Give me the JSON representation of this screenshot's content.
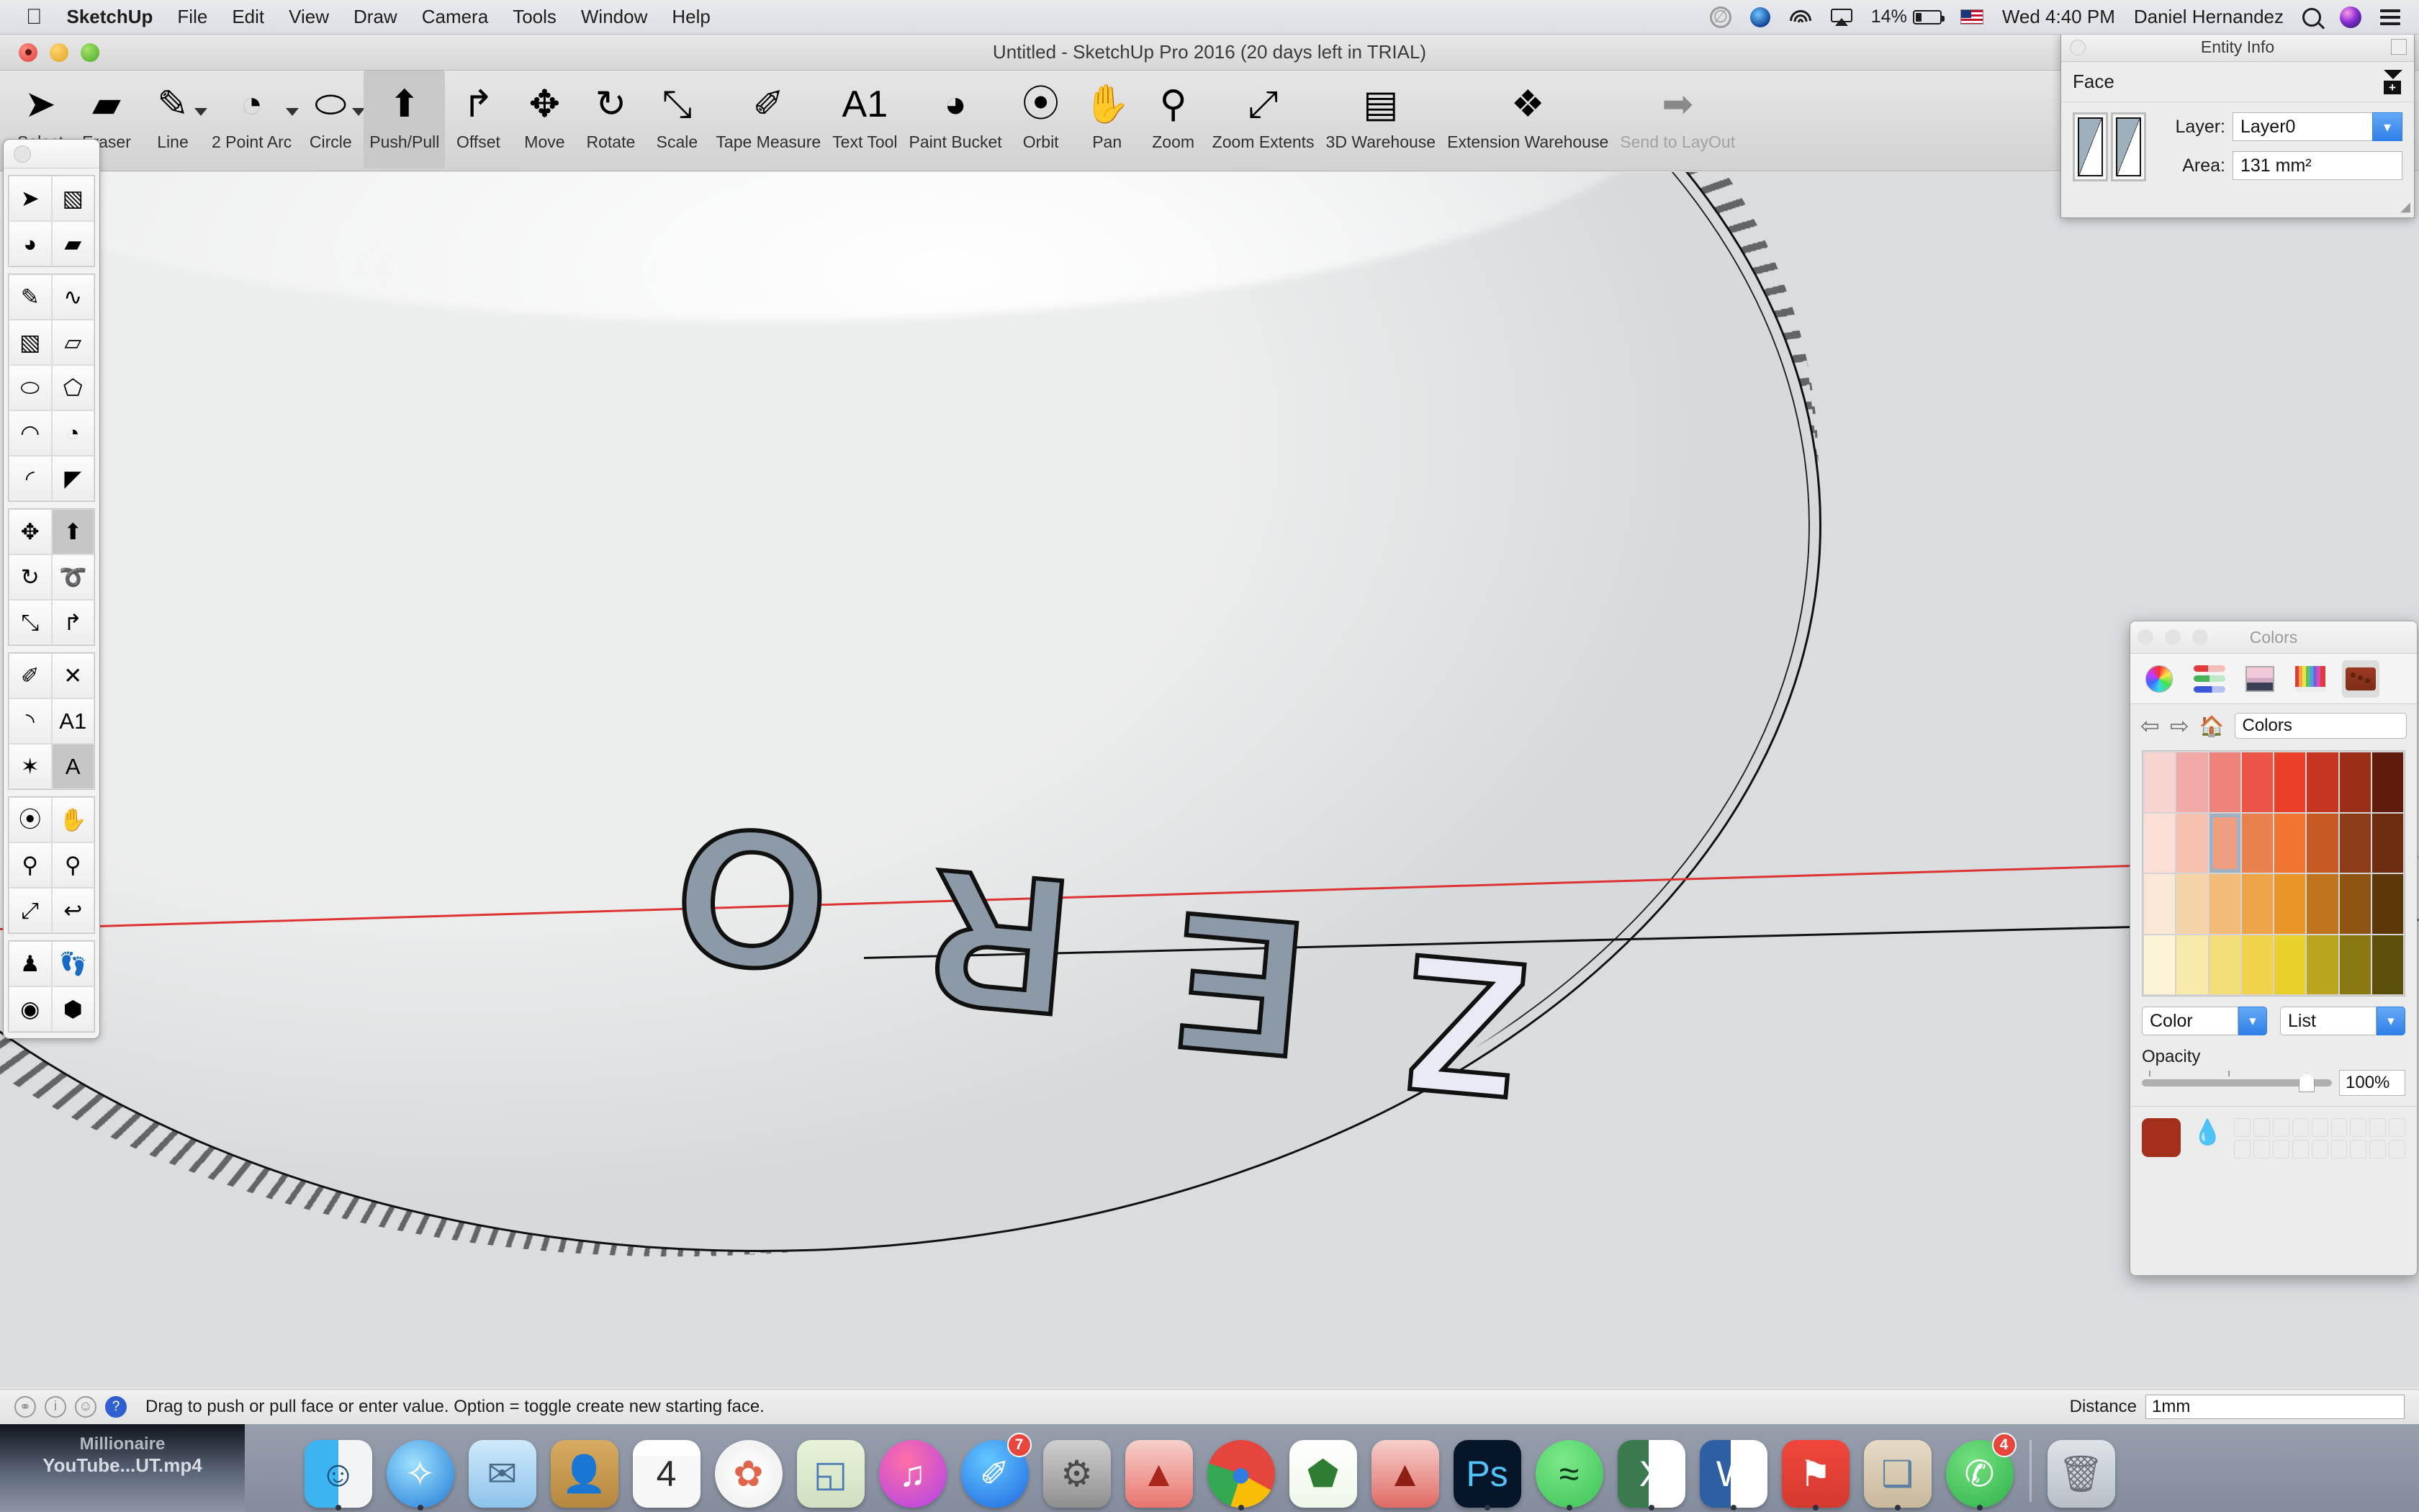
{
  "menubar": {
    "apple_icon": "apple-icon",
    "items": [
      "SketchUp",
      "File",
      "Edit",
      "View",
      "Draw",
      "Camera",
      "Tools",
      "Window",
      "Help"
    ],
    "status": {
      "creative_cloud_icon": "creative-cloud-icon",
      "dropbox_icon": "dropbox-icon",
      "wifi_icon": "wifi-icon",
      "airplay_icon": "airplay-icon",
      "battery_percent": "14%",
      "flag_icon": "us-flag-icon",
      "clock": "Wed 4:40 PM",
      "user": "Daniel Hernandez",
      "search_icon": "spotlight-search-icon",
      "siri_icon": "siri-icon",
      "notification_icon": "notification-center-icon"
    }
  },
  "window": {
    "title": "Untitled - SketchUp Pro 2016 (20 days left in TRIAL)"
  },
  "toolbar": {
    "items": [
      {
        "label": "Select",
        "icon": "arrow-cursor-icon",
        "glyph": "➤",
        "caret": false,
        "active": false,
        "disabled": false
      },
      {
        "label": "Eraser",
        "icon": "eraser-icon",
        "glyph": "▰",
        "caret": false,
        "active": false,
        "disabled": false
      },
      {
        "label": "Line",
        "icon": "pencil-line-icon",
        "glyph": "✎",
        "caret": true,
        "active": false,
        "disabled": false
      },
      {
        "label": "2 Point Arc",
        "icon": "two-point-arc-icon",
        "glyph": "◔",
        "caret": true,
        "active": false,
        "disabled": false
      },
      {
        "label": "Circle",
        "icon": "circle-icon",
        "glyph": "⬭",
        "caret": true,
        "active": false,
        "disabled": false
      },
      {
        "label": "Push/Pull",
        "icon": "push-pull-icon",
        "glyph": "⬆",
        "caret": false,
        "active": true,
        "disabled": false
      },
      {
        "label": "Offset",
        "icon": "offset-icon",
        "glyph": "↱",
        "caret": false,
        "active": false,
        "disabled": false
      },
      {
        "label": "Move",
        "icon": "move-icon",
        "glyph": "✥",
        "caret": false,
        "active": false,
        "disabled": false
      },
      {
        "label": "Rotate",
        "icon": "rotate-icon",
        "glyph": "↻",
        "caret": false,
        "active": false,
        "disabled": false
      },
      {
        "label": "Scale",
        "icon": "scale-icon",
        "glyph": "⤡",
        "caret": false,
        "active": false,
        "disabled": false
      },
      {
        "label": "Tape Measure",
        "icon": "tape-measure-icon",
        "glyph": "✐",
        "caret": false,
        "active": false,
        "disabled": false
      },
      {
        "label": "Text Tool",
        "icon": "text-tool-icon",
        "glyph": "A1",
        "caret": false,
        "active": false,
        "disabled": false
      },
      {
        "label": "Paint Bucket",
        "icon": "paint-bucket-icon",
        "glyph": "◕",
        "caret": false,
        "active": false,
        "disabled": false
      },
      {
        "label": "Orbit",
        "icon": "orbit-icon",
        "glyph": "⦿",
        "caret": false,
        "active": false,
        "disabled": false
      },
      {
        "label": "Pan",
        "icon": "pan-hand-icon",
        "glyph": "✋",
        "caret": false,
        "active": false,
        "disabled": false
      },
      {
        "label": "Zoom",
        "icon": "zoom-icon",
        "glyph": "⚲",
        "caret": false,
        "active": false,
        "disabled": false
      },
      {
        "label": "Zoom Extents",
        "icon": "zoom-extents-icon",
        "glyph": "⤢",
        "caret": false,
        "active": false,
        "disabled": false
      },
      {
        "label": "3D Warehouse",
        "icon": "3d-warehouse-icon",
        "glyph": "▤",
        "caret": false,
        "active": false,
        "disabled": false
      },
      {
        "label": "Extension Warehouse",
        "icon": "extension-warehouse-icon",
        "glyph": "❖",
        "caret": false,
        "active": false,
        "disabled": false
      },
      {
        "label": "Send to LayOut",
        "icon": "send-to-layout-icon",
        "glyph": "➡",
        "caret": false,
        "active": false,
        "disabled": true
      }
    ]
  },
  "palette": {
    "groups": [
      {
        "cells": [
          {
            "icon": "select-arrow-icon",
            "glyph": "➤",
            "selected": false
          },
          {
            "icon": "make-component-icon",
            "glyph": "▧",
            "selected": false
          },
          {
            "icon": "paint-bucket-icon",
            "glyph": "◕",
            "selected": false
          },
          {
            "icon": "eraser-icon",
            "glyph": "▰",
            "selected": false
          }
        ]
      },
      {
        "cells": [
          {
            "icon": "pencil-line-icon",
            "glyph": "✎",
            "selected": false
          },
          {
            "icon": "freehand-icon",
            "glyph": "∿",
            "selected": false
          },
          {
            "icon": "rectangle-icon",
            "glyph": "▧",
            "selected": false
          },
          {
            "icon": "rotated-rectangle-icon",
            "glyph": "▱",
            "selected": false
          },
          {
            "icon": "circle-icon",
            "glyph": "⬭",
            "selected": false
          },
          {
            "icon": "polygon-icon",
            "glyph": "⬠",
            "selected": false
          },
          {
            "icon": "arc-icon",
            "glyph": "◠",
            "selected": false
          },
          {
            "icon": "two-point-arc-icon",
            "glyph": "◔",
            "selected": false
          },
          {
            "icon": "three-point-arc-icon",
            "glyph": "◜",
            "selected": false
          },
          {
            "icon": "pie-icon",
            "glyph": "◤",
            "selected": false
          }
        ]
      },
      {
        "cells": [
          {
            "icon": "move-icon",
            "glyph": "✥",
            "selected": false
          },
          {
            "icon": "push-pull-icon",
            "glyph": "⬆",
            "selected": true
          },
          {
            "icon": "rotate-icon",
            "glyph": "↻",
            "selected": false
          },
          {
            "icon": "follow-me-icon",
            "glyph": "➰",
            "selected": false
          },
          {
            "icon": "scale-icon",
            "glyph": "⤡",
            "selected": false
          },
          {
            "icon": "offset-icon",
            "glyph": "↱",
            "selected": false
          }
        ]
      },
      {
        "cells": [
          {
            "icon": "tape-measure-icon",
            "glyph": "✐",
            "selected": false
          },
          {
            "icon": "dimension-icon",
            "glyph": "✕",
            "selected": false
          },
          {
            "icon": "protractor-icon",
            "glyph": "◝",
            "selected": false
          },
          {
            "icon": "text-tool-icon",
            "glyph": "A1",
            "selected": false
          },
          {
            "icon": "axes-icon",
            "glyph": "✶",
            "selected": false
          },
          {
            "icon": "3d-text-icon",
            "glyph": "A",
            "selected": true
          }
        ]
      },
      {
        "cells": [
          {
            "icon": "orbit-icon",
            "glyph": "⦿",
            "selected": false
          },
          {
            "icon": "pan-hand-icon",
            "glyph": "✋",
            "selected": false
          },
          {
            "icon": "zoom-icon",
            "glyph": "⚲",
            "selected": false
          },
          {
            "icon": "zoom-window-icon",
            "glyph": "⚲",
            "selected": false
          },
          {
            "icon": "zoom-extents-icon",
            "glyph": "⤢",
            "selected": false
          },
          {
            "icon": "previous-view-icon",
            "glyph": "↩",
            "selected": false
          }
        ]
      },
      {
        "cells": [
          {
            "icon": "position-camera-icon",
            "glyph": "♟",
            "selected": false
          },
          {
            "icon": "walk-icon",
            "glyph": "👣",
            "selected": false
          },
          {
            "icon": "look-around-icon",
            "glyph": "◉",
            "selected": false
          },
          {
            "icon": "section-plane-icon",
            "glyph": "⬢",
            "selected": false
          }
        ]
      }
    ]
  },
  "entity_info": {
    "panel_title": "Entity Info",
    "entity_type": "Face",
    "layer_label": "Layer:",
    "layer_value": "Layer0",
    "area_label": "Area:",
    "area_value": "131 mm²",
    "expand_icon": "expand-collapse-icon",
    "front_face_icon": "front-face-swatch-icon",
    "back_face_icon": "back-face-swatch-icon"
  },
  "colors_panel": {
    "panel_title": "Colors",
    "tabs": [
      {
        "name": "color-wheel-tab",
        "selected": false
      },
      {
        "name": "color-sliders-tab",
        "selected": false
      },
      {
        "name": "color-palettes-tab",
        "selected": false
      },
      {
        "name": "image-palettes-tab",
        "selected": false
      },
      {
        "name": "crayons-tab",
        "selected": false
      },
      {
        "name": "sketchup-materials-tab",
        "selected": true
      }
    ],
    "nav": {
      "back_icon": "back-arrow-icon",
      "forward_icon": "forward-arrow-icon",
      "home_icon": "home-icon",
      "field_value": "Colors"
    },
    "swatches": [
      "#f7d4d0",
      "#f2aaa6",
      "#ef8279",
      "#ea5548",
      "#ea4028",
      "#c63520",
      "#9c2d17",
      "#5f1a0c",
      "#fbdfd6",
      "#f4c2ae",
      "#ef9e81",
      "#ea7f50",
      "#ef7530",
      "#c75a22",
      "#8c3c17",
      "#6e2d11",
      "#fbe8d4",
      "#f6d3a7",
      "#f2bb78",
      "#eda447",
      "#e99528",
      "#c0741c",
      "#8d5414",
      "#5e3709",
      "#fdf4d6",
      "#f9e9a8",
      "#f4de79",
      "#f0d34b",
      "#ead02a",
      "#bba51c",
      "#8a7812",
      "#5c4f0a"
    ],
    "selected_swatch_index": 10,
    "selected_swatch_color": "#9c2d17",
    "left_popup": "Color",
    "right_popup": "List",
    "opacity_label": "Opacity",
    "opacity_value": "100%",
    "current_color": "#a4301b",
    "eyedropper_icon": "eyedropper-icon"
  },
  "model": {
    "text_on_cylinder": "ZERO",
    "face_fill_color": "#8c9aa8",
    "selected_letter": "Z",
    "selected_letter_fill": "#e8eaf6"
  },
  "status_bar": {
    "icons": [
      "privacy-icon",
      "info-icon",
      "person-icon",
      "help-icon"
    ],
    "message": "Drag to push or pull face or enter value.  Option = toggle create new starting face.",
    "distance_label": "Distance",
    "distance_value": "1mm"
  },
  "dock": {
    "items": [
      {
        "name": "finder",
        "glyph": "☺",
        "bg": "linear-gradient(90deg,#3db4f2 0 50%,#f2f4f6 50% 100%)",
        "color": "#1a4f78",
        "round": false,
        "running": true,
        "badge": null
      },
      {
        "name": "safari",
        "glyph": "✧",
        "bg": "radial-gradient(circle at 40% 35%,#9fe2ff,#1f7ad6)",
        "color": "#fff",
        "round": true,
        "running": true,
        "badge": null
      },
      {
        "name": "mail",
        "glyph": "✉",
        "bg": "linear-gradient(#cfe9fb,#8dc2ea)",
        "color": "#4a6b87",
        "round": false,
        "running": false,
        "badge": null
      },
      {
        "name": "contacts",
        "glyph": "👤",
        "bg": "linear-gradient(#d8ab63,#b5873f)",
        "color": "#8a6426",
        "round": false,
        "running": false,
        "badge": null
      },
      {
        "name": "calendar",
        "glyph": "4",
        "bg": "linear-gradient(#ffffff 0 24%,#f7f7f7 24% 100%)",
        "color": "#2b2b2b",
        "round": false,
        "running": false,
        "badge": null
      },
      {
        "name": "photos",
        "glyph": "✿",
        "bg": "radial-gradient(circle,#ffffff 18%,#f3f3f3 60%)",
        "color": "#e0654a",
        "round": true,
        "running": false,
        "badge": null
      },
      {
        "name": "maps",
        "glyph": "◱",
        "bg": "linear-gradient(#e9f2d9,#cfe0c0)",
        "color": "#4c7ab5",
        "round": false,
        "running": false,
        "badge": null
      },
      {
        "name": "itunes",
        "glyph": "♫",
        "bg": "radial-gradient(circle at 40% 30%,#ff6fa6,#b042e8)",
        "color": "#fff",
        "round": true,
        "running": false,
        "badge": null
      },
      {
        "name": "app-store",
        "glyph": "✐",
        "bg": "radial-gradient(circle at 40% 30%,#63c8ff,#1f67e0)",
        "color": "#fff",
        "round": true,
        "running": false,
        "badge": "7"
      },
      {
        "name": "system-preferences",
        "glyph": "⚙",
        "bg": "linear-gradient(#cfcfcf,#8f8f8f)",
        "color": "#4a4a4a",
        "round": false,
        "running": false,
        "badge": null
      },
      {
        "name": "autocad-1",
        "glyph": "▲",
        "bg": "linear-gradient(#f7cfcb,#e8756c)",
        "color": "#a9261c",
        "round": false,
        "running": false,
        "badge": null
      },
      {
        "name": "chrome",
        "glyph": "●",
        "bg": "conic-gradient(#e4453c 0 33%,#fbbc05 33% 55%,#34a853 55% 80%,#e4453c 80% 100%)",
        "color": "#2f7de0",
        "round": true,
        "running": true,
        "badge": null
      },
      {
        "name": "graph-app",
        "glyph": "⬟",
        "bg": "linear-gradient(#ffffff,#eef7e8)",
        "color": "#2e7d32",
        "round": false,
        "running": false,
        "badge": null
      },
      {
        "name": "autocad-2",
        "glyph": "▲",
        "bg": "linear-gradient(#f7cfcb,#e06b63)",
        "color": "#8f1f16",
        "round": false,
        "running": false,
        "badge": null
      },
      {
        "name": "photoshop",
        "glyph": "Ps",
        "bg": "#061529",
        "color": "#4fc3f7",
        "round": false,
        "running": true,
        "badge": null
      },
      {
        "name": "spotify",
        "glyph": "≈",
        "bg": "radial-gradient(circle at 40% 30%,#7ce98a,#3ec255)",
        "color": "#10381a",
        "round": true,
        "running": true,
        "badge": null
      },
      {
        "name": "excel",
        "glyph": "X",
        "bg": "linear-gradient(90deg,#3a7a4e 0 46%,#ffffff 46% 100%)",
        "color": "#ffffff",
        "round": false,
        "running": true,
        "badge": null
      },
      {
        "name": "word",
        "glyph": "W",
        "bg": "linear-gradient(90deg,#2e5fa3 0 46%,#ffffff 46% 100%)",
        "color": "#ffffff",
        "round": false,
        "running": true,
        "badge": null
      },
      {
        "name": "sketchup",
        "glyph": "⚑",
        "bg": "linear-gradient(#f0473c,#d6392f)",
        "color": "#ffffff",
        "round": false,
        "running": true,
        "badge": null
      },
      {
        "name": "preview",
        "glyph": "❑",
        "bg": "linear-gradient(#e7dbc6,#c8b89c)",
        "color": "#5c7fa3",
        "round": false,
        "running": true,
        "badge": null
      },
      {
        "name": "whatsapp",
        "glyph": "✆",
        "bg": "radial-gradient(circle at 40% 30%,#73e07f,#2fb14a)",
        "color": "#ffffff",
        "round": true,
        "running": true,
        "badge": "4"
      },
      {
        "name": "trash",
        "glyph": "🗑",
        "bg": "linear-gradient(#dfe3e8,#b9bec6)",
        "color": "#6b7079",
        "round": false,
        "running": false,
        "badge": null
      }
    ]
  },
  "video_tile": {
    "line1": "Millionaire",
    "line2": "YouTube...UT.mp4"
  }
}
